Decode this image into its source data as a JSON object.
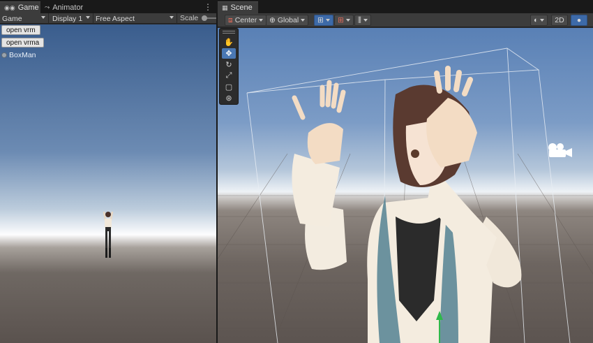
{
  "game": {
    "tabs": [
      {
        "label": "Game",
        "icon": "gamepad-icon"
      },
      {
        "label": "Animator",
        "icon": "animator-icon"
      }
    ],
    "toolbar": {
      "mode": "Game",
      "display": "Display 1",
      "aspect": "Free Aspect",
      "scale_label": "Scale"
    },
    "buttons": {
      "open_vrm": "open vrm",
      "open_vrma": "open vrma"
    },
    "object_label": "BoxMan"
  },
  "scene": {
    "tab": {
      "label": "Scene",
      "icon": "grid-icon"
    },
    "toolbar": {
      "pivot": "Center",
      "space": "Global",
      "mode_2d": "2D"
    },
    "tools": [
      "hand-tool",
      "move-tool",
      "rotate-tool",
      "scale-tool",
      "rect-tool",
      "transform-tool"
    ],
    "active_tool": "move-tool"
  },
  "colors": {
    "accent": "#3d6aa8",
    "panel": "#282828",
    "toolbar": "#3c3c3c"
  }
}
